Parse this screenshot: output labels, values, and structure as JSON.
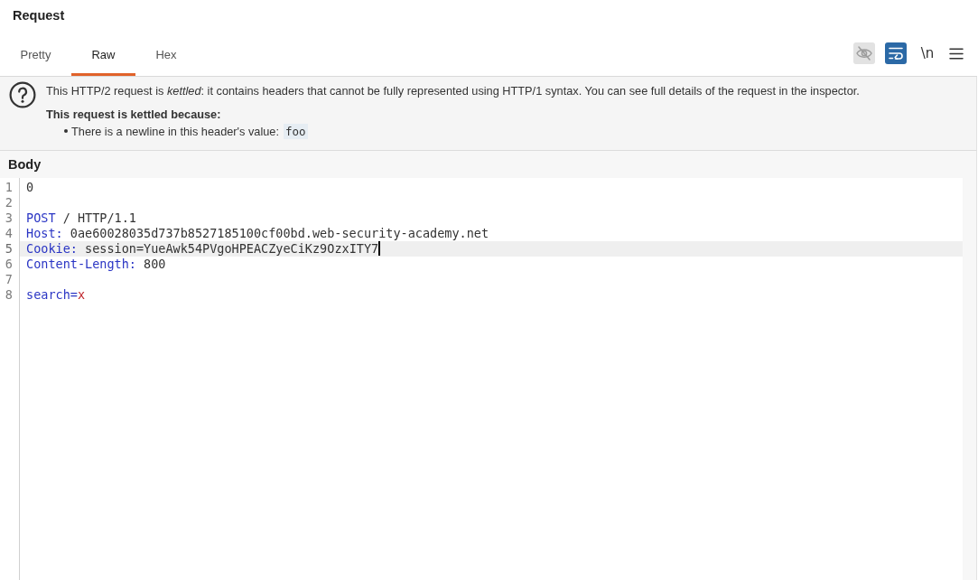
{
  "panel": {
    "title": "Request"
  },
  "tabs": [
    {
      "label": "Pretty",
      "selected": false
    },
    {
      "label": "Raw",
      "selected": true
    },
    {
      "label": "Hex",
      "selected": false
    }
  ],
  "toolbar": [
    {
      "kind": "visibility",
      "on": false,
      "disabled": true
    },
    {
      "kind": "wrap",
      "on": true,
      "disabled": false
    },
    {
      "kind": "newline",
      "label": "\\n",
      "on": false,
      "disabled": false
    },
    {
      "kind": "menu",
      "on": false,
      "disabled": false
    }
  ],
  "notice": {
    "message": "This HTTP/2 request is *kettled*: it contains headers that cannot be fully represented using HTTP/1 syntax. You can see full details of the request in the inspector.",
    "reason_heading": "This request is kettled because:",
    "reasons": [
      {
        "text": "There is a newline in this header's value:",
        "value": "foo"
      }
    ]
  },
  "body": {
    "title": "Body",
    "lines": [
      {
        "number": "1",
        "cursor": false,
        "segments": [
          {
            "kind": "text",
            "text": "0"
          }
        ]
      },
      {
        "number": "2",
        "cursor": false
      },
      {
        "number": "3",
        "cursor": false,
        "segments": [
          {
            "kind": "keyword",
            "text": "POST"
          },
          {
            "kind": "text",
            "text": " / HTTP/1.1"
          }
        ]
      },
      {
        "number": "4",
        "cursor": false,
        "segments": [
          {
            "kind": "keyword",
            "text": "Host:"
          },
          {
            "kind": "text",
            "text": " 0ae60028035d737b8527185100cf00bd.web-security-academy.net"
          }
        ]
      },
      {
        "number": "5",
        "cursor": true,
        "segments": [
          {
            "kind": "keyword",
            "text": "Cookie:"
          },
          {
            "kind": "text",
            "text": " session=YueAwk54PVgoHPEACZyeCiKz9OzxITY7"
          }
        ]
      },
      {
        "number": "6",
        "cursor": false,
        "segments": [
          {
            "kind": "keyword",
            "text": "Content-Length:"
          },
          {
            "kind": "text",
            "text": " 800"
          }
        ]
      },
      {
        "number": "7",
        "cursor": false
      },
      {
        "number": "8",
        "cursor": false,
        "segments": [
          {
            "kind": "keyword",
            "text": "search="
          },
          {
            "kind": "param",
            "text": "x"
          }
        ]
      }
    ]
  }
}
